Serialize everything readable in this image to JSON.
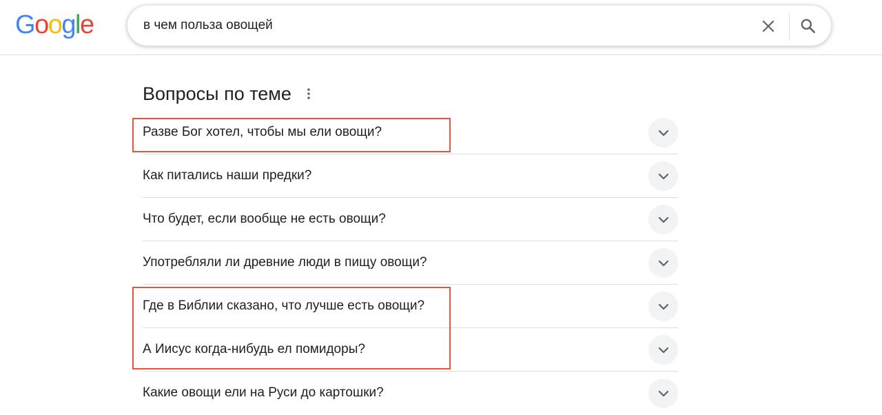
{
  "logo": {
    "letters": [
      "G",
      "o",
      "o",
      "g",
      "l",
      "e"
    ],
    "colors": [
      "#4285F4",
      "#EA4335",
      "#FBBC05",
      "#4285F4",
      "#34A853",
      "#EA4335"
    ]
  },
  "search": {
    "query": "в чем польза овощей",
    "clear_icon": "close-icon",
    "search_icon": "search-icon"
  },
  "related_questions": {
    "title": "Вопросы по теме",
    "more_icon": "more-vert-icon",
    "expand_icon": "chevron-down-icon",
    "items": [
      {
        "text": "Разве Бог хотел, чтобы мы ели овощи?"
      },
      {
        "text": "Как питались наши предки?"
      },
      {
        "text": "Что будет, если вообще не есть овощи?"
      },
      {
        "text": "Употребляли ли древние люди в пищу овощи?"
      },
      {
        "text": "Где в Библии сказано, что лучше есть овощи?"
      },
      {
        "text": "А Иисус когда-нибудь ел помидоры?"
      },
      {
        "text": "Какие овощи ели на Руси до картошки?"
      }
    ]
  },
  "annotation_color": "#e8523f"
}
